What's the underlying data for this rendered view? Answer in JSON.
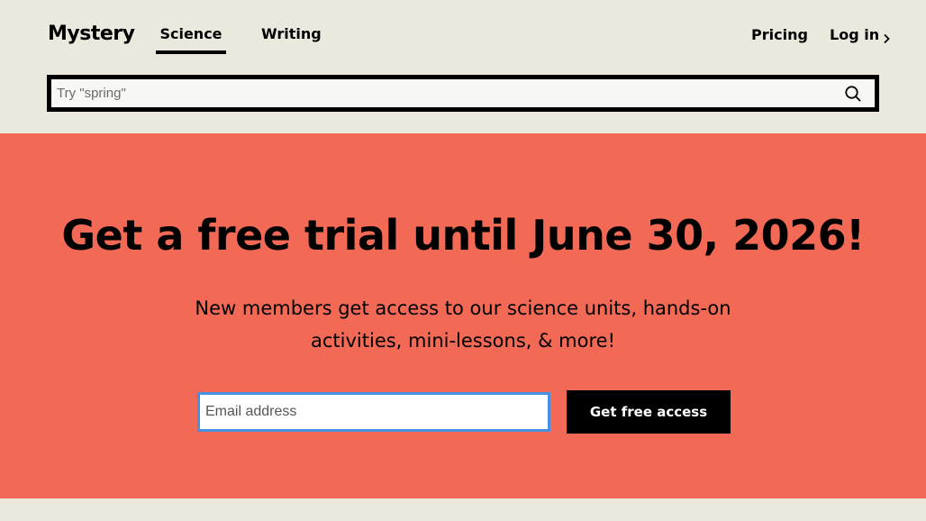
{
  "header": {
    "logo_text": "Mystery",
    "nav_tabs": [
      {
        "label": "Science",
        "active": true
      },
      {
        "label": "Writing",
        "active": false
      }
    ],
    "pricing_label": "Pricing",
    "login_label": "Log in",
    "search": {
      "placeholder": "Try \"spring\"",
      "value": "",
      "icon": "search-icon"
    }
  },
  "hero": {
    "background_color": "#f26a55",
    "title": "Get a free trial until June 30, 2026!",
    "subtitle": "New members get access to our science units, hands-on activities, mini-lessons, & more!",
    "email_placeholder": "Email address",
    "email_value": "",
    "cta_label": "Get free access"
  },
  "colors": {
    "page_background": "#ebe9de",
    "hero_background": "#f26a55",
    "focus_ring": "#4a90e2",
    "button_background": "#000000"
  }
}
